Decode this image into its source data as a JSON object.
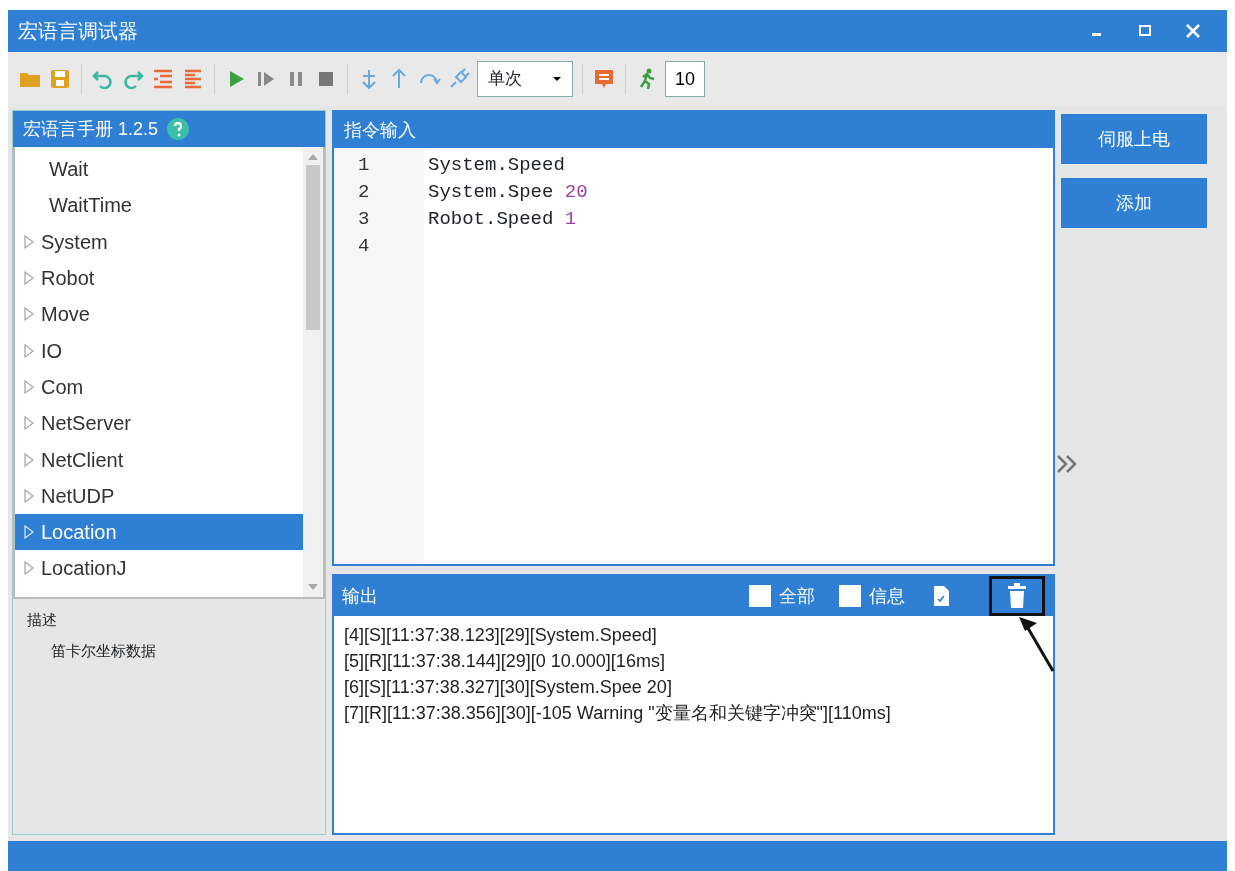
{
  "window": {
    "title": "宏语言调试器"
  },
  "toolbar": {
    "run_mode": "单次",
    "step_count": "10"
  },
  "manual": {
    "title": "宏语言手册 1.2.5",
    "items": [
      {
        "label": "Wait",
        "kind": "leaf",
        "selected": false
      },
      {
        "label": "WaitTime",
        "kind": "leaf",
        "selected": false
      },
      {
        "label": "System",
        "kind": "group",
        "selected": false
      },
      {
        "label": "Robot",
        "kind": "group",
        "selected": false
      },
      {
        "label": "Move",
        "kind": "group",
        "selected": false
      },
      {
        "label": "IO",
        "kind": "group",
        "selected": false
      },
      {
        "label": "Com",
        "kind": "group",
        "selected": false
      },
      {
        "label": "NetServer",
        "kind": "group",
        "selected": false
      },
      {
        "label": "NetClient",
        "kind": "group",
        "selected": false
      },
      {
        "label": "NetUDP",
        "kind": "group",
        "selected": false
      },
      {
        "label": "Location",
        "kind": "group",
        "selected": true
      },
      {
        "label": "LocationJ",
        "kind": "group",
        "selected": false
      }
    ],
    "description_label": "描述",
    "description": "笛卡尔坐标数据"
  },
  "editor": {
    "title": "指令输入",
    "lines": [
      {
        "number": "1",
        "parts": [
          {
            "text": "System.Speed",
            "kind": "ident"
          }
        ]
      },
      {
        "number": "2",
        "parts": [
          {
            "text": "System.Spee",
            "kind": "ident"
          },
          {
            "text": "20",
            "kind": "number"
          }
        ]
      },
      {
        "number": "3",
        "parts": [
          {
            "text": "Robot.Speed",
            "kind": "ident"
          },
          {
            "text": "1",
            "kind": "number"
          }
        ]
      },
      {
        "number": "4"
      }
    ]
  },
  "output": {
    "title": "输出",
    "filters": [
      {
        "label": "全部",
        "checked": false
      },
      {
        "label": "信息",
        "checked": false
      }
    ],
    "lines": [
      "[4][S][11:37:38.123][29][System.Speed]",
      "[5][R][11:37:38.144][29][0 10.000][16ms]",
      "[6][S][11:37:38.327][30][System.Spee 20]",
      "[7][R][11:37:38.356][30][-105 Warning \"变量名和关键字冲突\"][110ms]"
    ]
  },
  "actions": [
    "伺服上电",
    "添加"
  ]
}
